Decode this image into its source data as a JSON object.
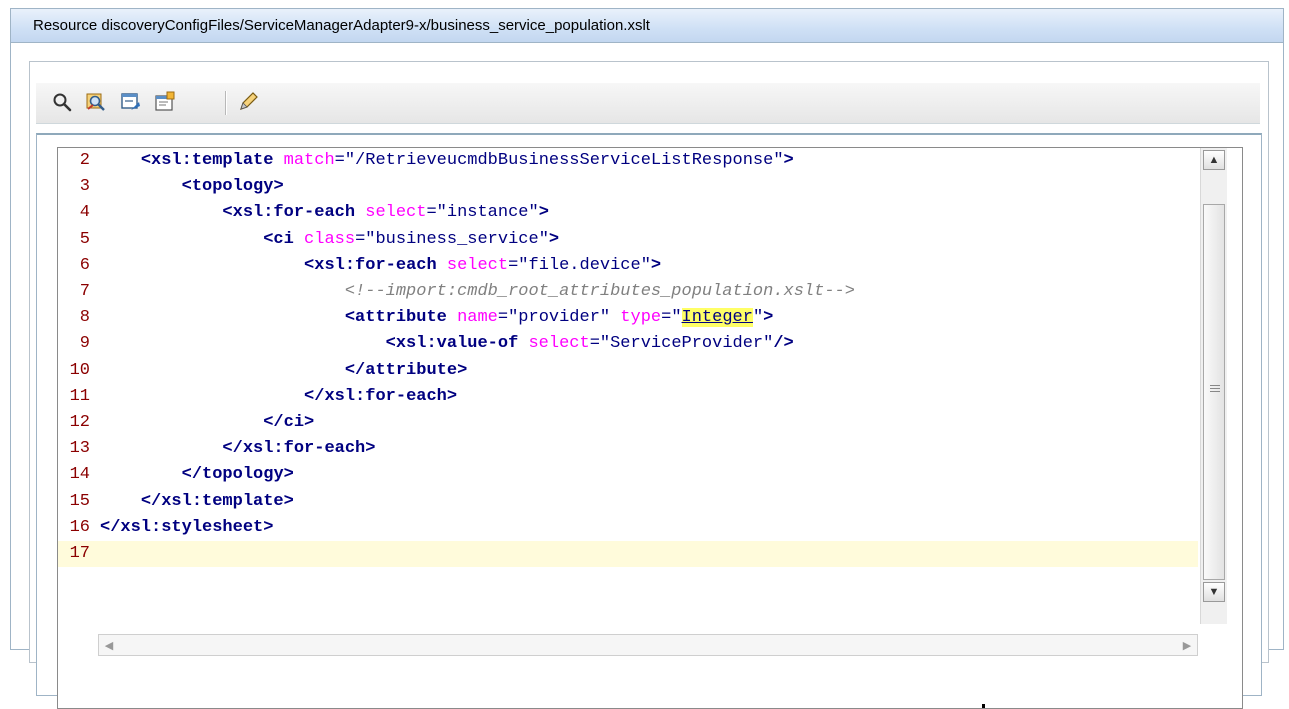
{
  "window": {
    "title": "Resource discoveryConfigFiles/ServiceManagerAdapter9-x/business_service_population.xslt"
  },
  "toolbar": {
    "buttons": [
      {
        "icon": "search-icon"
      },
      {
        "icon": "find-replace-icon"
      },
      {
        "icon": "go-to-line-icon"
      },
      {
        "icon": "properties-icon"
      },
      {
        "icon": "edit-pencil-icon"
      }
    ]
  },
  "editor": {
    "current_line": 17,
    "lines": [
      {
        "num": "2",
        "text": "    <xsl:template match=\"/RetrieveucmdbBusinessServiceListResponse\">"
      },
      {
        "num": "3",
        "text": "        <topology>"
      },
      {
        "num": "4",
        "text": "            <xsl:for-each select=\"instance\">"
      },
      {
        "num": "5",
        "text": "                <ci class=\"business_service\">"
      },
      {
        "num": "6",
        "text": "                    <xsl:for-each select=\"file.device\">"
      },
      {
        "num": "7",
        "text": "                        <!--import:cmdb_root_attributes_population.xslt-->"
      },
      {
        "num": "8",
        "text": "                        <attribute name=\"provider\" type=\"Integer\">"
      },
      {
        "num": "9",
        "text": "                            <xsl:value-of select=\"ServiceProvider\"/>"
      },
      {
        "num": "10",
        "text": "                        </attribute>"
      },
      {
        "num": "11",
        "text": "                    </xsl:for-each>"
      },
      {
        "num": "12",
        "text": "                </ci>"
      },
      {
        "num": "13",
        "text": "            </xsl:for-each>"
      },
      {
        "num": "14",
        "text": "        </topology>"
      },
      {
        "num": "15",
        "text": "    </xsl:template>"
      },
      {
        "num": "16",
        "text": "</xsl:stylesheet>"
      },
      {
        "num": "17",
        "text": ""
      }
    ]
  },
  "colors": {
    "tag": "#000080",
    "attribute": "#ff00ff",
    "comment": "#808080",
    "line_number": "#8b0000",
    "current_line_bg": "#fffbdb",
    "highlight": "#ffff66",
    "titlebar": "#cfe0f5"
  }
}
